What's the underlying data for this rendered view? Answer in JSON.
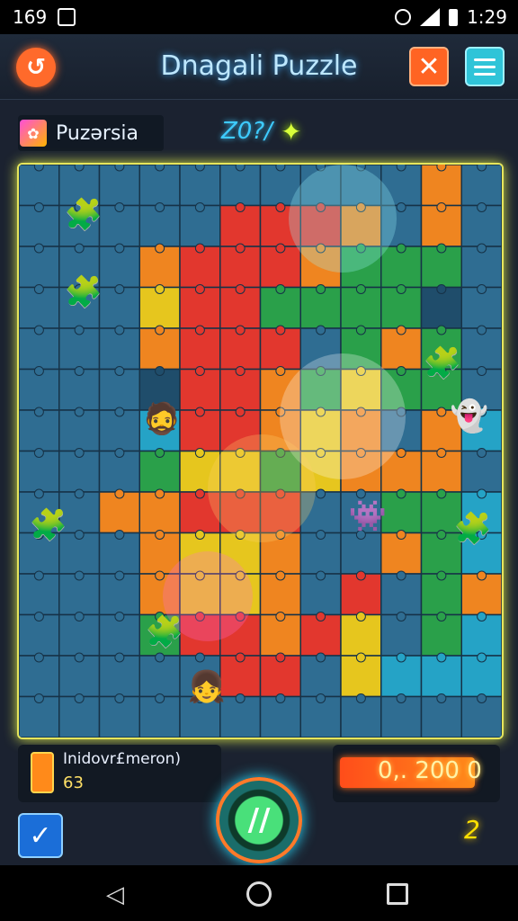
{
  "status_bar": {
    "time_left": "169",
    "time_right": "1:29"
  },
  "header": {
    "title": "Dnagali Puzzle"
  },
  "player": {
    "name": "Puzərsia"
  },
  "score": {
    "label": "Z0?/",
    "badge": "✦"
  },
  "board": {
    "colors": [
      "#2f6d92",
      "#e6c61e",
      "#e2372e",
      "#2aa04a",
      "#ef8520",
      "#25a3c6",
      "#7a3fb0",
      "#1f4d6b"
    ],
    "border_color": "#e6e65c"
  },
  "info_card": {
    "title": "Inidovr£meron)",
    "value": "63"
  },
  "score_card": {
    "value": "0,. 200 0"
  },
  "action_button": {
    "label": "//"
  },
  "level_mark": "2",
  "icons": {
    "back": "swirl-icon",
    "tools": "crossed-tools-icon",
    "menu": "hamburger-icon",
    "check": "checkmark-icon",
    "action": "pencil-icon"
  }
}
